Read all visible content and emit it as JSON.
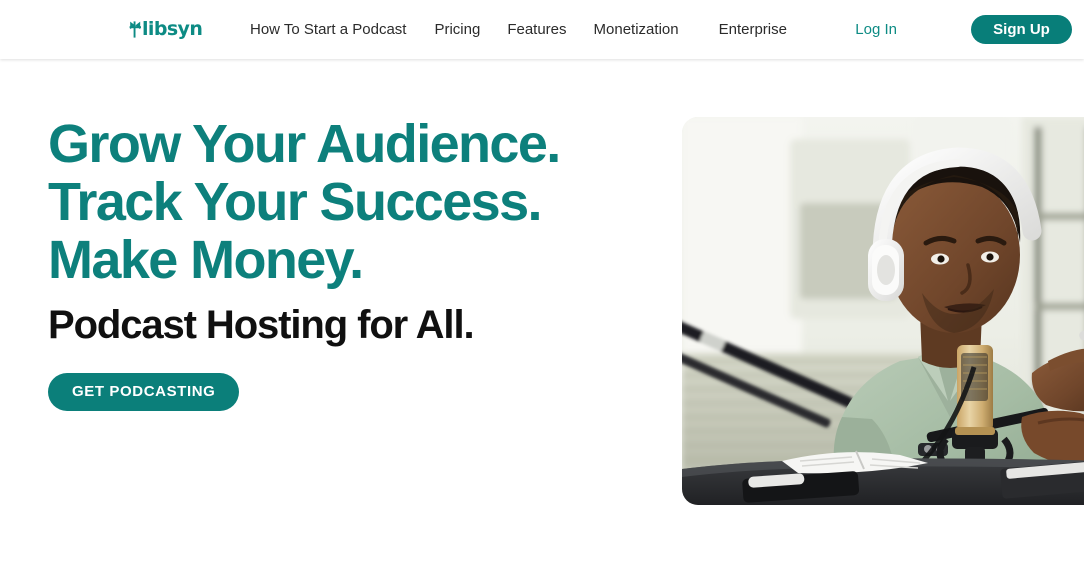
{
  "header": {
    "logo": {
      "text": "libsyn",
      "mark": "libsyn-bowtie-mark",
      "color": "#0d8b84"
    },
    "nav": [
      {
        "label": "How To Start a Podcast"
      },
      {
        "label": "Pricing"
      },
      {
        "label": "Features"
      },
      {
        "label": "Monetization"
      },
      {
        "label": "Enterprise"
      }
    ],
    "login_label": "Log In",
    "signup_label": "Sign Up",
    "signup_color": "#087e79"
  },
  "hero": {
    "headline_lines": [
      "Grow Your Audience.",
      "Track Your Success.",
      "Make Money."
    ],
    "headline_color": "#0d807c",
    "subheadline": "Podcast Hosting for All.",
    "subheadline_color": "#101010",
    "cta_label": "GET PODCASTING",
    "cta_color": "#0b7f7a",
    "image": {
      "alt": "Podcaster wearing white headphones speaking into a gold condenser microphone at a studio desk",
      "shirt_color": "#a9bfa8",
      "mic_color": "#d8b87a",
      "desk_color": "#2f3033"
    }
  }
}
